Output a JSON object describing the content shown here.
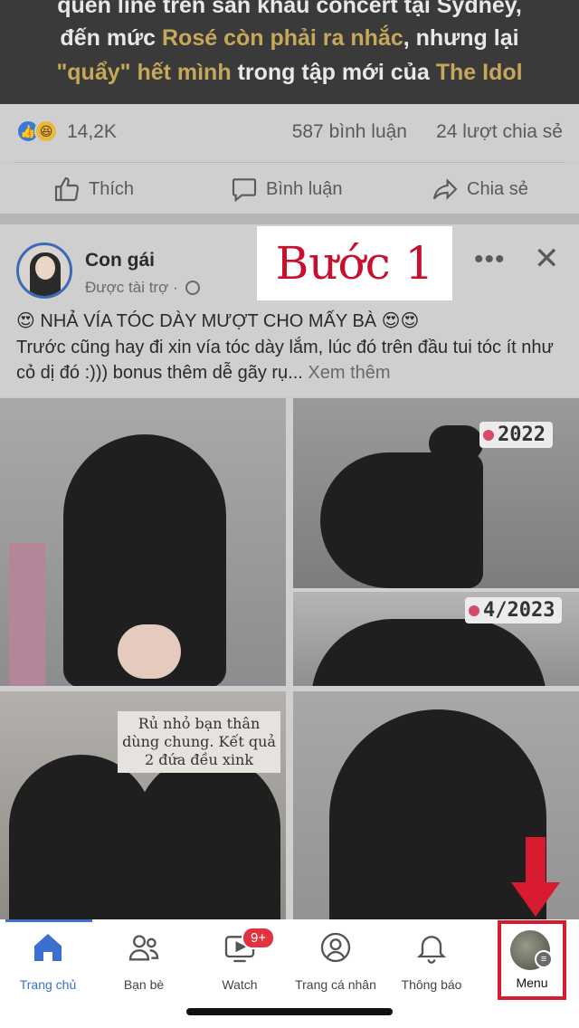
{
  "banner": {
    "line1": "quên line trên sân khấu concert tại Sydney,",
    "line2_prefix": "đến mức ",
    "line2_highlight": "Rosé còn phải ra nhắc",
    "line2_suffix": ", nhưng lại",
    "line3_hl1": "\"quẩy\" hết mình",
    "line3_mid": " trong tập mới của ",
    "line3_hl2": "The Idol"
  },
  "stats": {
    "reaction_count": "14,2K",
    "comments": "587 bình luận",
    "shares": "24 lượt chia sẻ"
  },
  "actions": {
    "like": "Thích",
    "comment": "Bình luận",
    "share": "Chia sẻ"
  },
  "post": {
    "author": "Con gái",
    "sponsored": "Được tài trợ ·",
    "step_overlay": "Bước 1",
    "headline": "😍 NHẢ VÍA TÓC DÀY MƯỢT CHO MẤY BÀ 😍😍",
    "body": "Trước cũng hay đi xin vía tóc dày lắm, lúc đó trên đầu tui tóc ít như cỏ dị đó :))) bonus thêm dễ gãy rụ...",
    "see_more": "Xem thêm"
  },
  "photos": {
    "tag_2022": "2022",
    "tag_2023": "4/2023",
    "caption": "Rủ nhỏ bạn thân dùng chung. Kết quả 2 đứa đều xink"
  },
  "tabs": [
    {
      "label": "Trang chủ",
      "icon": "home-icon",
      "active": true
    },
    {
      "label": "Bạn bè",
      "icon": "friends-icon"
    },
    {
      "label": "Watch",
      "icon": "watch-icon",
      "badge": "9+"
    },
    {
      "label": "Trang cá nhân",
      "icon": "profile-icon"
    },
    {
      "label": "Thông báo",
      "icon": "bell-icon"
    },
    {
      "label": "Menu",
      "icon": "menu-avatar-icon"
    }
  ],
  "colors": {
    "accent": "#3b6fd0",
    "highlight_red": "#d81b2e",
    "badge_red": "#e0333f",
    "banner_gold": "#c6a85a"
  }
}
